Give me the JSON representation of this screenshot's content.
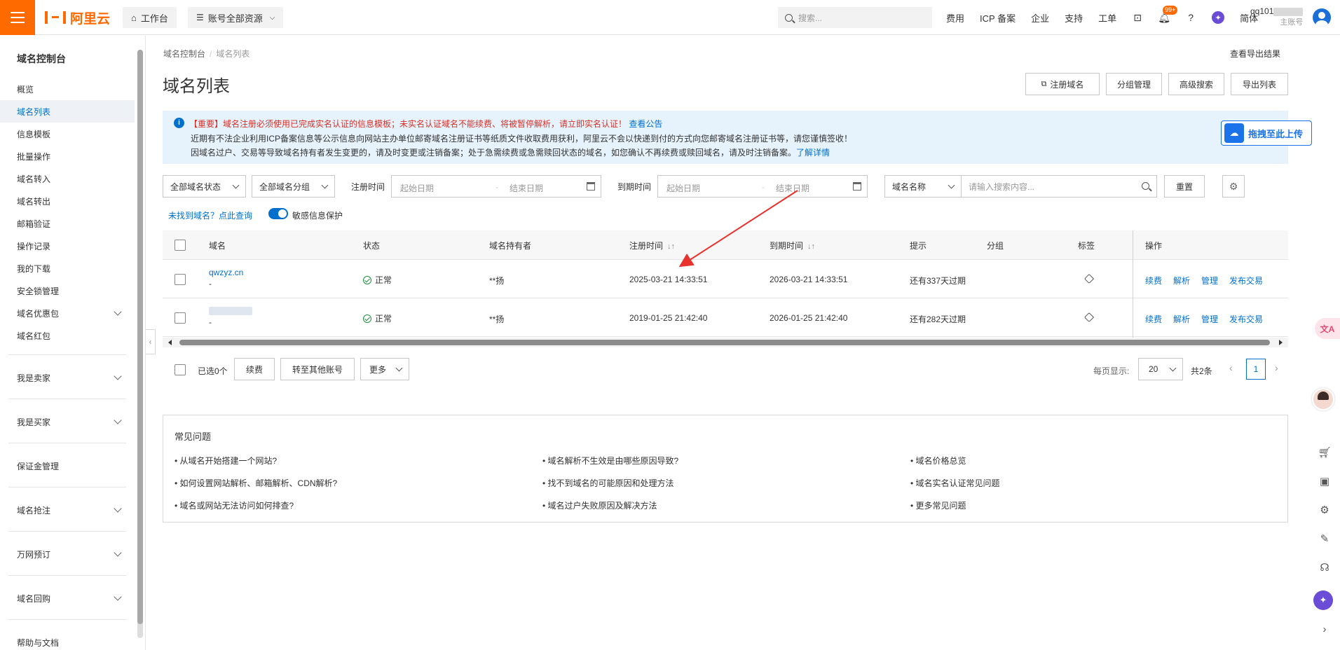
{
  "topbar": {
    "logo_text": "阿里云",
    "workbench": "工作台",
    "resources": "账号全部资源",
    "search_placeholder": "搜索...",
    "links": [
      "费用",
      "ICP 备案",
      "企业",
      "支持",
      "工单"
    ],
    "notification_badge": "99+",
    "language": "简体",
    "account_name": "qq101",
    "account_role": "主账号"
  },
  "sidebar": {
    "title": "域名控制台",
    "items": [
      "概览",
      "域名列表",
      "信息模板",
      "批量操作",
      "域名转入",
      "域名转出",
      "邮箱验证",
      "操作记录",
      "我的下载",
      "安全锁管理",
      "域名优惠包",
      "域名红包"
    ],
    "active_index": 1,
    "groups": [
      "我是卖家",
      "我是买家",
      "保证金管理",
      "域名抢注",
      "万网预订",
      "域名回购",
      "帮助与文档"
    ]
  },
  "breadcrumb": [
    "域名控制台",
    "域名列表"
  ],
  "export_results_link": "查看导出结果",
  "page_title": "域名列表",
  "toolbar": {
    "register": "注册域名",
    "group_manage": "分组管理",
    "advanced_search": "高级搜索",
    "export_list": "导出列表"
  },
  "notice": {
    "line1_important": "【重要】域名注册必须使用已完成实名认证的信息模板；未实名认证域名不能续费、将被暂停解析，请立即实名认证！",
    "line1_link": "查看公告",
    "line2": "近期有不法企业利用ICP备案信息等公示信息向网站主办单位邮寄域名注册证书等纸质文件收取费用获利，阿里云不会以快递到付的方式向您邮寄域名注册证书等，请您谨慎签收！",
    "line3": "因域名过户、交易等导致域名持有者发生变更的，请及时变更或注销备案；处于急需续费或急需赎回状态的域名，如您确认不再续费或赎回域名，请及时注销备案。",
    "line3_link": "了解详情"
  },
  "upload_button": "拖拽至此上传",
  "filters": {
    "status": "全部域名状态",
    "group": "全部域名分组",
    "reg_time_label": "注册时间",
    "exp_time_label": "到期时间",
    "start_placeholder": "起始日期",
    "end_placeholder": "结束日期",
    "search_field": "域名名称",
    "search_placeholder": "请输入搜索内容...",
    "reset": "重置",
    "not_found_link": "未找到域名？点此查询",
    "privacy_label": "敏感信息保护"
  },
  "table": {
    "columns": [
      "域名",
      "状态",
      "域名持有者",
      "注册时间",
      "到期时间",
      "提示",
      "分组",
      "标签",
      "操作"
    ],
    "rows": [
      {
        "domain": "qwzyz.cn",
        "sub": "-",
        "status": "正常",
        "owner": "**扬",
        "reg": "2025-03-21 14:33:51",
        "exp": "2026-03-21 14:33:51",
        "hint": "还有337天过期"
      },
      {
        "domain": "",
        "sub": "-",
        "status": "正常",
        "owner": "**扬",
        "reg": "2019-01-25 21:42:40",
        "exp": "2026-01-25 21:42:40",
        "hint": "还有282天过期"
      }
    ],
    "actions": [
      "续费",
      "解析",
      "管理",
      "发布交易"
    ]
  },
  "bulk": {
    "selected": "已选0个",
    "renew": "续费",
    "transfer": "转至其他账号",
    "more": "更多"
  },
  "pagination": {
    "page_size_label": "每页显示:",
    "page_size": "20",
    "total": "共2条",
    "current": "1"
  },
  "faq": {
    "title": "常见问题",
    "items": [
      "• 从域名开始搭建一个网站?",
      "• 域名解析不生效是由哪些原因导致?",
      "• 域名价格总览",
      "• 如何设置网站解析、邮箱解析、CDN解析?",
      "• 找不到域名的可能原因和处理方法",
      "• 域名实名认证常见问题",
      "• 域名或网站无法访问如何排查?",
      "• 域名过户失败原因及解决方法",
      "• 更多常见问题"
    ]
  },
  "colors": {
    "brand": "#ff6a00",
    "link": "#0070cc",
    "arrow": "#e8322e"
  }
}
